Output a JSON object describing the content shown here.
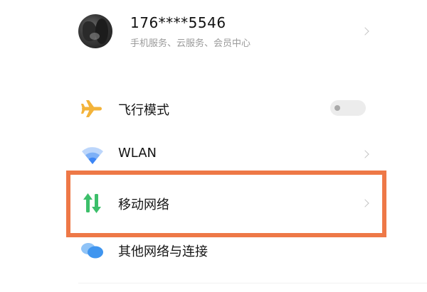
{
  "account": {
    "name": "176****5546",
    "subtitle": "手机服务、云服务、会员中心"
  },
  "settings": {
    "items": [
      {
        "label": "飞行模式",
        "icon": "airplane-icon",
        "control": "toggle",
        "toggle_on": false
      },
      {
        "label": "WLAN",
        "icon": "wifi-icon",
        "control": "chevron"
      },
      {
        "label": "移动网络",
        "icon": "mobile-data-icon",
        "control": "chevron",
        "highlighted": true
      },
      {
        "label": "其他网络与连接",
        "icon": "connections-icon",
        "control": "none"
      }
    ]
  },
  "colors": {
    "highlight": "#ee7847",
    "airplane": "#f3b33a",
    "wifi": "#3d86f5",
    "mobile_data": "#3cbf6a",
    "connections": "#4a9cf0"
  }
}
